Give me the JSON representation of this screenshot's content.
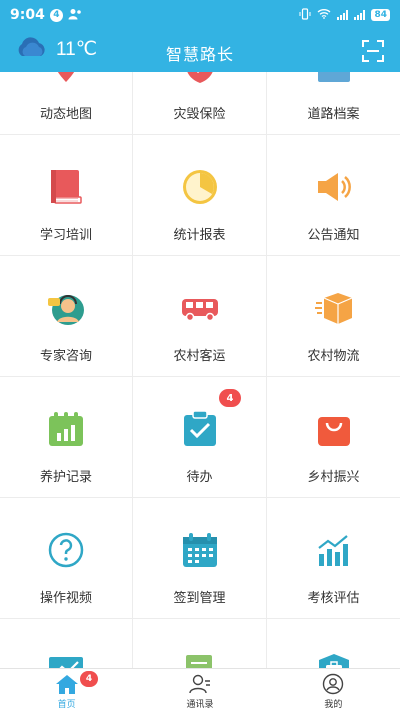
{
  "status_bar": {
    "time": "9:04",
    "notif_count": "4",
    "battery": "84"
  },
  "header": {
    "temperature": "11℃",
    "title": "智慧路长",
    "weather_icon": "cloud-icon",
    "scan_icon": "scan-icon"
  },
  "grid": {
    "items": [
      {
        "label": "动态地图",
        "icon": "map-icon"
      },
      {
        "label": "灾毁保险",
        "icon": "insurance-icon"
      },
      {
        "label": "道路档案",
        "icon": "archive-icon"
      },
      {
        "label": "学习培训",
        "icon": "book-icon"
      },
      {
        "label": "统计报表",
        "icon": "pie-chart-icon"
      },
      {
        "label": "公告通知",
        "icon": "megaphone-icon"
      },
      {
        "label": "专家咨询",
        "icon": "expert-icon"
      },
      {
        "label": "农村客运",
        "icon": "bus-icon"
      },
      {
        "label": "农村物流",
        "icon": "package-icon"
      },
      {
        "label": "养护记录",
        "icon": "calendar-chart-icon"
      },
      {
        "label": "待办",
        "icon": "clipboard-check-icon",
        "badge": "4"
      },
      {
        "label": "乡村振兴",
        "icon": "shopping-bag-icon"
      },
      {
        "label": "操作视频",
        "icon": "help-icon"
      },
      {
        "label": "签到管理",
        "icon": "calendar-icon"
      },
      {
        "label": "考核评估",
        "icon": "bar-chart-icon"
      },
      {
        "label": "",
        "icon": "trend-board-icon"
      },
      {
        "label": "",
        "icon": "document-edit-icon"
      },
      {
        "label": "",
        "icon": "briefcase-icon"
      }
    ]
  },
  "tab_bar": {
    "items": [
      {
        "label": "首页",
        "icon": "home-icon",
        "badge": "4",
        "active": true
      },
      {
        "label": "通讯录",
        "icon": "contacts-icon"
      },
      {
        "label": "我的",
        "icon": "profile-icon"
      }
    ]
  },
  "colors": {
    "primary": "#33b3e3",
    "badge": "#f04e4e",
    "tab_active": "#33a8e0"
  }
}
